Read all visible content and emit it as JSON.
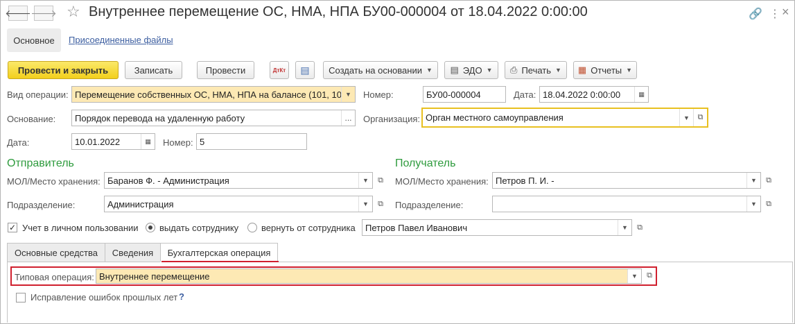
{
  "window": {
    "title": "Внутреннее перемещение ОС, НМА, НПА БУ00-000004 от 18.04.2022 0:00:00",
    "back_icon": "arrow-left-icon",
    "forward_icon": "arrow-right-icon"
  },
  "tabs": {
    "main": "Основное",
    "files": "Присоединенные файлы"
  },
  "toolbar": {
    "post_close": "Провести и закрыть",
    "save": "Записать",
    "post": "Провести",
    "dt_kt_icon": "ДтКт",
    "create_based": "Создать на основании",
    "edo": "ЭДО",
    "print": "Печать",
    "reports": "Отчеты"
  },
  "form": {
    "op_type_label": "Вид операции:",
    "op_type_value": "Перемещение собственных ОС, НМА, НПА на балансе (101, 10",
    "number_label": "Номер:",
    "number_value": "БУ00-000004",
    "date_label": "Дата:",
    "date_value": "18.04.2022  0:00:00",
    "basis_label": "Основание:",
    "basis_value": "Порядок перевода на удаленную работу",
    "basis_btn": "...",
    "org_label": "Организация:",
    "org_value": "Орган местного самоуправления",
    "doc_date_label": "Дата:",
    "doc_date_value": "10.01.2022",
    "doc_number_label": "Номер:",
    "doc_number_value": "5"
  },
  "sender": {
    "title": "Отправитель",
    "mol_label": "МОЛ/Место хранения:",
    "mol_value": "Баранов Ф. - Администрация",
    "dept_label": "Подразделение:",
    "dept_value": "Администрация"
  },
  "receiver": {
    "title": "Получатель",
    "mol_label": "МОЛ/Место хранения:",
    "mol_value": "Петров П. И. -",
    "dept_label": "Подразделение:",
    "dept_value": ""
  },
  "personal": {
    "checkbox_label": "Учет в личном пользовании",
    "checked": true,
    "radio_give": "выдать сотруднику",
    "radio_return": "вернуть от сотрудника",
    "selected": "give",
    "employee_value": "Петров Павел Иванович"
  },
  "lower_tabs": {
    "fixed_assets": "Основные средства",
    "info": "Сведения",
    "accounting": "Бухгалтерская операция",
    "active": "accounting"
  },
  "accounting": {
    "typical_label": "Типовая операция:",
    "typical_value": "Внутреннее перемещение",
    "fix_errors_label": "Исправление ошибок прошлых лет",
    "fix_errors_checked": false,
    "help": "?"
  },
  "colors": {
    "primary_button": "#f2cf1c",
    "field_highlight": "#fde9b4",
    "section_title": "#2e9b3d",
    "red_outline": "#d0202e",
    "org_outline": "#e8c020",
    "link": "#3c5ea0"
  }
}
